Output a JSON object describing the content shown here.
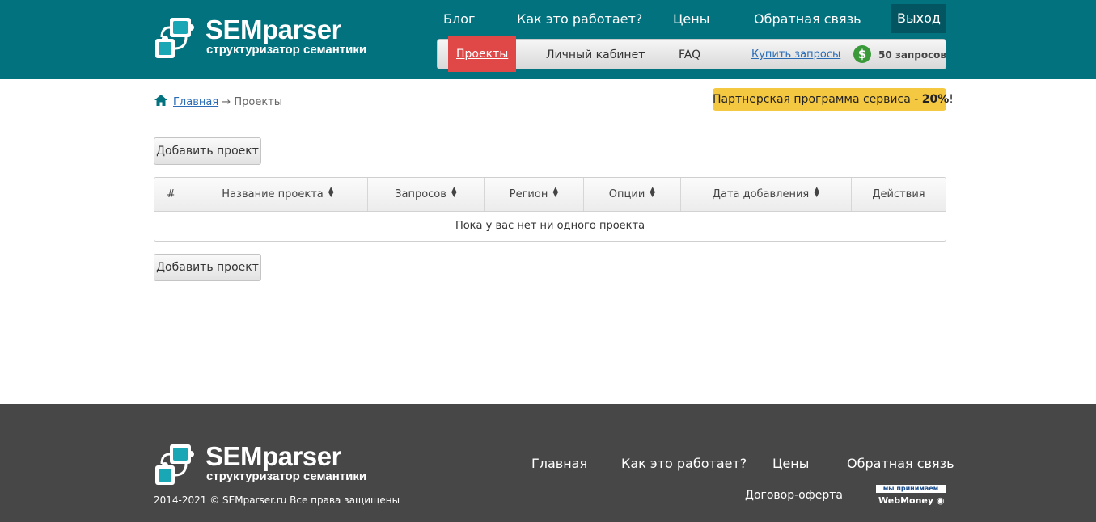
{
  "header": {
    "logo_name": "SEMparser",
    "logo_tagline": "структуризатор семантики",
    "nav": [
      "Блог",
      "Как это работает?",
      "Цены",
      "Обратная связь"
    ],
    "exit": "Выход",
    "subnav": {
      "projects": "Проекты",
      "cabinet": "Личный кабинет",
      "faq": "FAQ",
      "buy": "Купить запросы",
      "balance": "50 запросов"
    }
  },
  "breadcrumb": {
    "home": "Главная",
    "separator": "→",
    "current": "Проекты"
  },
  "partner": {
    "text": "Партнерская программа сервиса - ",
    "percent": "20%",
    "suffix": "!"
  },
  "buttons": {
    "add_project": "Добавить проект"
  },
  "table": {
    "columns": [
      "#",
      "Название проекта",
      "Запросов",
      "Регион",
      "Опции",
      "Дата добавления",
      "Действия"
    ],
    "empty_message": "Пока у вас нет ни одного проекта"
  },
  "footer": {
    "logo_name": "SEMparser",
    "logo_tagline": "структуризатор семантики",
    "copyright": "2014-2021 © SEMparser.ru Все права защищены",
    "nav": [
      "Главная",
      "Как это работает?",
      "Цены",
      "Обратная связь"
    ],
    "offer": "Договор-оферта",
    "webmoney_top": "мы принимаем",
    "webmoney_bottom": "WebMoney"
  },
  "colors": {
    "header_bg": "#02727f",
    "active_tab": "#e04848",
    "partner_bg": "#f5c842",
    "footer_bg": "#474747"
  }
}
